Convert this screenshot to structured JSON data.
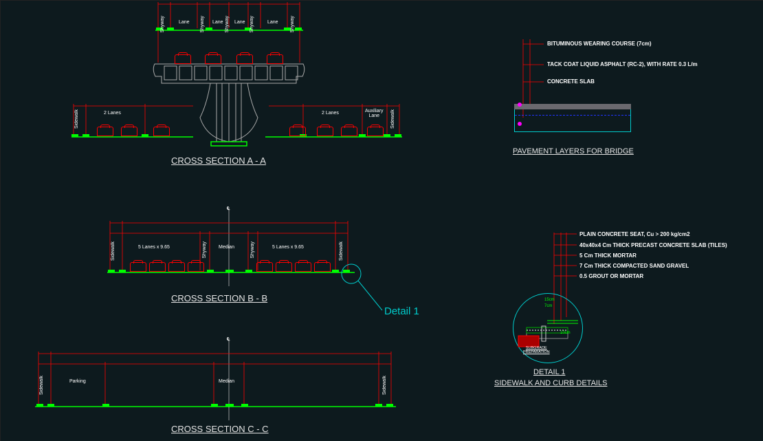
{
  "sections": {
    "a": {
      "title": "CROSS SECTION A - A"
    },
    "b": {
      "title": "CROSS SECTION B - B"
    },
    "c": {
      "title": "CROSS SECTION C - C"
    }
  },
  "a_labels": {
    "lane": "Lane",
    "shyway": "Shyway",
    "two_lanes": "2 Lanes",
    "aux_lane": "Auxiliary\nLane",
    "sidewalk": "Sidewalk"
  },
  "b_labels": {
    "lanes_left": "5 Lanes x 9.65",
    "median": "Median",
    "lanes_right": "5 Lanes x 9.65",
    "sidewalk": "Sidewalk",
    "shyway": "Shyway"
  },
  "c_labels": {
    "parking": "Parking",
    "median": "Median",
    "sidewalk": "Sidewalk"
  },
  "callout": {
    "text": "Detail 1"
  },
  "pavement": {
    "title": "PAVEMENT LAYERS FOR BRIDGE",
    "notes": [
      "BITUMINOUS WEARING COURSE (7cm)",
      "TACK COAT LIQUID ASPHALT (RC-2), WITH RATE 0.3 L/m",
      "CONCRETE SLAB"
    ]
  },
  "detail1": {
    "title": "DETAIL 1",
    "subtitle": "SIDEWALK AND CURB DETAILS",
    "notes": [
      "PLAIN CONCRETE SEAT, Cu > 200 kg/cm2",
      "40x40x4 Cm THICK PRECAST CONCRETE SLAB (TILES)",
      "5 Cm THICK MORTAR",
      "7 Cm THICK COMPACTED SAND GRAVEL",
      "0.5 GROUT OR MORTAR"
    ],
    "dims": {
      "a": "15cm",
      "b": "7cm",
      "c": "10cm"
    },
    "sub_label": "SUBGRADE\nPREPARATION"
  },
  "centerline": "℄"
}
